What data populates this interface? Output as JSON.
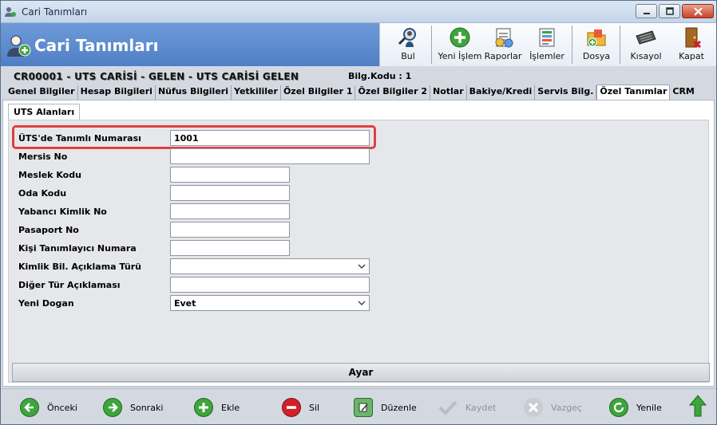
{
  "window": {
    "title": "Cari Tanımları"
  },
  "header": {
    "title": "Cari Tanımları"
  },
  "toolbar": [
    {
      "label": "Bul",
      "icon": "magnifier-person-icon"
    },
    {
      "label": "Yeni İşlem",
      "icon": "plus-circle-icon"
    },
    {
      "label": "Raporlar",
      "icon": "report-icon"
    },
    {
      "label": "İşlemler",
      "icon": "transactions-icon"
    },
    {
      "label": "Dosya",
      "icon": "folder-icon"
    },
    {
      "label": "Kısayol",
      "icon": "keyboard-icon"
    },
    {
      "label": "Kapat",
      "icon": "exit-door-icon"
    }
  ],
  "record": {
    "code": "CR00001 - UTS CARİSİ - GELEN - UTS CARİSİ GELEN",
    "bilg": "Bilg.Kodu : 1"
  },
  "tabs": [
    "Genel Bilgiler",
    "Hesap Bilgileri",
    "Nüfus Bilgileri",
    "Yetkililer",
    "Özel Bilgiler 1",
    "Özel Bilgiler 2",
    "Notlar",
    "Bakiye/Kredi",
    "Servis Bilg.",
    "Özel Tanımlar",
    "CRM"
  ],
  "active_tab": "Özel Tanımlar",
  "subtab": "UTS Alanları",
  "fields": [
    {
      "label": "ÜTS'de Tanımlı Numarası",
      "value": "1001"
    },
    {
      "label": "Mersis No",
      "value": ""
    },
    {
      "label": "Meslek Kodu",
      "value": ""
    },
    {
      "label": "Oda Kodu",
      "value": ""
    },
    {
      "label": "Yabancı Kimlik No",
      "value": ""
    },
    {
      "label": "Pasaport No",
      "value": ""
    },
    {
      "label": "Kişi Tanımlayıcı Numara",
      "value": ""
    },
    {
      "label": "Kimlik Bil. Açıklama Türü",
      "value": ""
    },
    {
      "label": "Diğer Tür Açıklaması",
      "value": ""
    },
    {
      "label": "Yeni Dogan",
      "value": "Evet"
    }
  ],
  "ayar_label": "Ayar",
  "bottom": [
    {
      "label": "Önceki",
      "icon": "arrow-left-icon",
      "enabled": true
    },
    {
      "label": "Sonraki",
      "icon": "arrow-right-icon",
      "enabled": true
    },
    {
      "label": "Ekle",
      "icon": "plus-icon",
      "enabled": true
    },
    {
      "label": "Sil",
      "icon": "minus-icon",
      "enabled": true
    },
    {
      "label": "Düzenle",
      "icon": "edit-icon",
      "enabled": true
    },
    {
      "label": "Kaydet",
      "icon": "check-icon",
      "enabled": false
    },
    {
      "label": "Vazgeç",
      "icon": "cancel-icon",
      "enabled": false
    },
    {
      "label": "Yenile",
      "icon": "refresh-icon",
      "enabled": true
    }
  ],
  "colors": {
    "header": "#5b89cc",
    "highlight": "#e0403f",
    "green": "#3ea43c",
    "red": "#d2202a"
  }
}
